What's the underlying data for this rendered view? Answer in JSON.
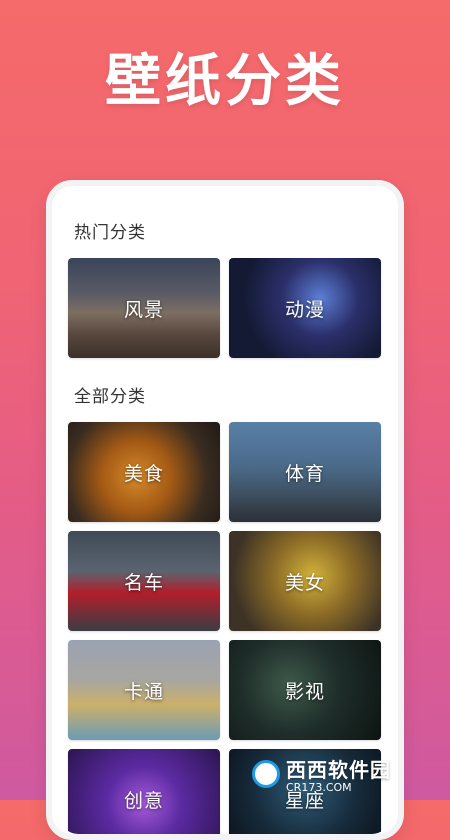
{
  "headline": "壁纸分类",
  "sections": {
    "hot": {
      "title": "热门分类",
      "items": [
        {
          "label": "风景",
          "icon": "scenery-thumbnail"
        },
        {
          "label": "动漫",
          "icon": "anime-thumbnail"
        }
      ]
    },
    "all": {
      "title": "全部分类",
      "items": [
        {
          "label": "美食",
          "icon": "food-thumbnail"
        },
        {
          "label": "体育",
          "icon": "sports-thumbnail"
        },
        {
          "label": "名车",
          "icon": "cars-thumbnail"
        },
        {
          "label": "美女",
          "icon": "beauty-thumbnail"
        },
        {
          "label": "卡通",
          "icon": "cartoon-thumbnail"
        },
        {
          "label": "影视",
          "icon": "film-thumbnail"
        },
        {
          "label": "创意",
          "icon": "creative-thumbnail"
        },
        {
          "label": "星座",
          "icon": "zodiac-thumbnail"
        }
      ]
    }
  },
  "watermark": {
    "text": "西西软件园",
    "subtext": "CR173.COM",
    "color": "#1e9be6"
  },
  "colors": {
    "background_top": "#f56a6a",
    "background_bottom": "#cf5aa0"
  }
}
